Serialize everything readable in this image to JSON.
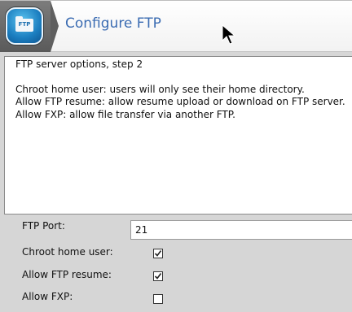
{
  "header": {
    "title": "Configure FTP",
    "logo_text": "FTP"
  },
  "info": {
    "lines": [
      "FTP server options, step 2",
      "",
      "Chroot home user: users will only see their home directory.",
      "Allow FTP resume: allow resume upload or download on FTP server.",
      "Allow FXP: allow file transfer via another FTP."
    ]
  },
  "form": {
    "ftp_port_label": "FTP Port:",
    "ftp_port_value": "21",
    "chroot_label": "Chroot home user:",
    "chroot_checked": true,
    "resume_label": "Allow FTP resume:",
    "resume_checked": true,
    "fxp_label": "Allow FXP:",
    "fxp_checked": false
  }
}
